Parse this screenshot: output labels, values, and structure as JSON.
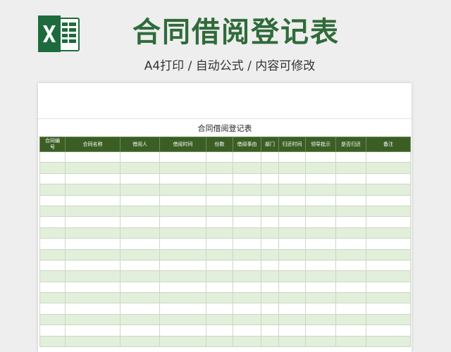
{
  "header": {
    "title": "合同借阅登记表",
    "subtitle": "A4打印 / 自动公式 / 内容可修改"
  },
  "sheet": {
    "table_title": "合同借阅登记表",
    "columns": [
      "合同编号",
      "合同名称",
      "借阅人",
      "借阅时间",
      "份数",
      "借阅事由",
      "部门",
      "归还时间",
      "领导批示",
      "是否归还",
      "备注"
    ],
    "row_count": 18
  },
  "colors": {
    "brand_green": "#2f6b3a",
    "header_fill": "#3b5e24",
    "band_fill": "#e2efda"
  },
  "icons": {
    "logo": "excel-logo-icon"
  }
}
